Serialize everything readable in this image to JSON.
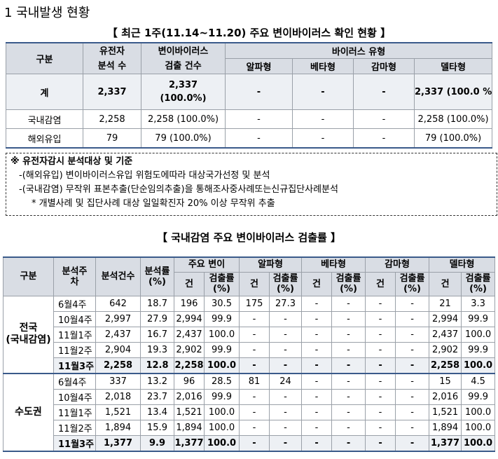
{
  "section_title": "1  국내발생 현황",
  "table1": {
    "caption": "【 최근 1주(11.14~11.20) 주요 변이바이러스 확인 현황 】",
    "headers": {
      "category": "구분",
      "analysis": "유전자\n분석 수",
      "detected": "변이바이러스\n검출 건수",
      "virus_type": "바이러스 유형",
      "alpha": "알파형",
      "beta": "베타형",
      "gamma": "감마형",
      "delta": "델타형"
    },
    "rows": [
      {
        "label": "계",
        "analysis": "2,337",
        "detected": "2,337",
        "detected_pct": "(100.0%)",
        "alpha": "-",
        "beta": "-",
        "gamma": "-",
        "delta": "2,337 (100.0 %)"
      },
      {
        "label": "국내감염",
        "analysis": "2,258",
        "detected": "2,258 (100.0%)",
        "alpha": "-",
        "beta": "-",
        "gamma": "-",
        "delta": "2,258 (100.0%)"
      },
      {
        "label": "해외유입",
        "analysis": "79",
        "detected": "79 (100.0%)",
        "alpha": "-",
        "beta": "-",
        "gamma": "-",
        "delta": "79 (100.0%)"
      }
    ]
  },
  "note": {
    "title": "※ 유전자감시 분석대상 및 기준",
    "line1": "-(해외유입) 변이바이러스유입 위험도에따라 대상국가선정 및 분석",
    "line2": "-(국내감염) 무작위 표본추출(단순임의추출)을 통해조사중사례또는신규집단사례분석",
    "line3": "* 개별사례 및 집단사례 대상 일일확진자 20% 이상 무작위 추출"
  },
  "table2": {
    "caption": "【 국내감염 주요 변이바이러스 검출률 】",
    "headers": {
      "category": "구분",
      "week": "분석주\n차",
      "count": "분석건수",
      "rate": "분석률\n(%)",
      "main": "주요 변이",
      "alpha": "알파형",
      "beta": "베타형",
      "gamma": "감마형",
      "delta": "델타형",
      "cases": "건",
      "det_rate": "검출률\n(%)"
    },
    "groups": [
      {
        "region": "전국\n(국내감염)",
        "rows": [
          [
            "6월4주",
            "642",
            "18.7",
            "196",
            "30.5",
            "175",
            "27.3",
            "-",
            "-",
            "-",
            "-",
            "21",
            "3.3"
          ],
          [
            "10월4주",
            "2,997",
            "27.9",
            "2,994",
            "99.9",
            "-",
            "-",
            "-",
            "-",
            "-",
            "-",
            "2,994",
            "99.9"
          ],
          [
            "11월1주",
            "2,437",
            "16.7",
            "2,437",
            "100.0",
            "-",
            "-",
            "-",
            "-",
            "-",
            "-",
            "2,437",
            "100.0"
          ],
          [
            "11월2주",
            "2,904",
            "19.3",
            "2,902",
            "99.9",
            "-",
            "-",
            "-",
            "-",
            "-",
            "-",
            "2,902",
            "99.9"
          ],
          [
            "11월3주",
            "2,258",
            "12.8",
            "2,258",
            "100.0",
            "-",
            "-",
            "-",
            "-",
            "-",
            "-",
            "2,258",
            "100.0"
          ]
        ]
      },
      {
        "region": "수도권",
        "rows": [
          [
            "6월4주",
            "337",
            "13.2",
            "96",
            "28.5",
            "81",
            "24",
            "-",
            "-",
            "-",
            "-",
            "15",
            "4.5"
          ],
          [
            "10월4주",
            "2,018",
            "23.7",
            "2,016",
            "99.9",
            "-",
            "-",
            "-",
            "-",
            "-",
            "-",
            "2,016",
            "99.9"
          ],
          [
            "11월1주",
            "1,521",
            "13.4",
            "1,521",
            "100.0",
            "-",
            "-",
            "-",
            "-",
            "-",
            "-",
            "1,521",
            "100.0"
          ],
          [
            "11월2주",
            "1,894",
            "15.9",
            "1,894",
            "100.0",
            "-",
            "-",
            "-",
            "-",
            "-",
            "-",
            "1,894",
            "100.0"
          ],
          [
            "11월3주",
            "1,377",
            "9.9",
            "1,377",
            "100.0",
            "-",
            "-",
            "-",
            "-",
            "-",
            "-",
            "1,377",
            "100.0"
          ]
        ]
      }
    ]
  }
}
